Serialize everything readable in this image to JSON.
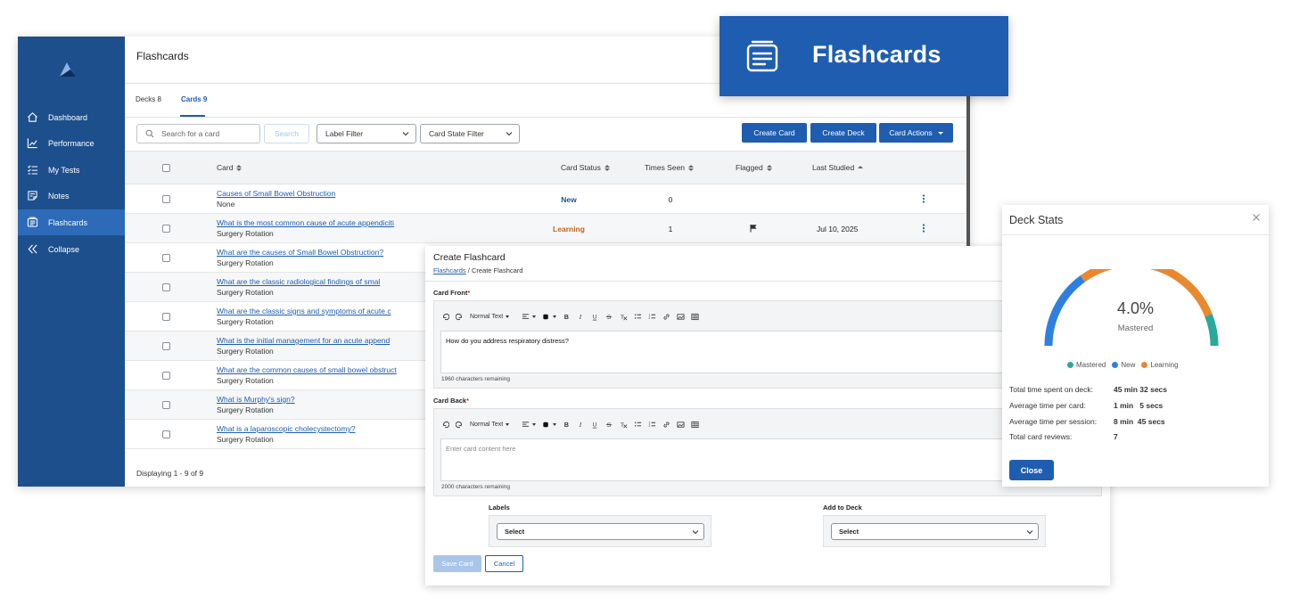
{
  "colors": {
    "brand": "#1f5db0",
    "sidebar": "#1d4f8c",
    "sidebar_active": "#2d6bb8",
    "status_new": "#1f4f9a",
    "status_learning": "#c0651a",
    "mastered": "#2aa89a",
    "new": "#2f7fe0",
    "learning": "#e8892f"
  },
  "sidebar": {
    "items": [
      {
        "label": "Dashboard",
        "icon": "home-icon"
      },
      {
        "label": "Performance",
        "icon": "chart-line-icon"
      },
      {
        "label": "My Tests",
        "icon": "checklist-icon"
      },
      {
        "label": "Notes",
        "icon": "note-icon"
      },
      {
        "label": "Flashcards",
        "icon": "flashcard-icon",
        "active": true
      },
      {
        "label": "Collapse",
        "icon": "double-chevron-left-icon"
      }
    ]
  },
  "page": {
    "title": "Flashcards"
  },
  "tabs": [
    {
      "label": "Decks 8"
    },
    {
      "label": "Cards 9",
      "active": true
    }
  ],
  "toolbar": {
    "search_placeholder": "Search for a card",
    "search_button": "Search",
    "label_filter": "Label Filter",
    "state_filter": "Card State Filter",
    "create_card": "Create Card",
    "create_deck": "Create Deck",
    "card_actions": "Card Actions"
  },
  "table": {
    "headers": {
      "card": "Card",
      "status": "Card Status",
      "seen": "Times Seen",
      "flagged": "Flagged",
      "last": "Last Studied"
    },
    "rows": [
      {
        "title": "Causes of Small Bowel Obstruction",
        "sub": "None",
        "status": "New",
        "seen": "0",
        "flagged": false,
        "date": "",
        "menu": true
      },
      {
        "title": "What is the most common cause of acute appendiciti",
        "sub": "Surgery Rotation",
        "status": "Learning",
        "seen": "1",
        "flagged": true,
        "date": "Jul 10, 2025",
        "menu": true
      },
      {
        "title": "What are the causes of Small Bowel Obstruction?",
        "sub": "Surgery Rotation"
      },
      {
        "title": "What are the classic radiological findings of smal",
        "sub": "Surgery Rotation"
      },
      {
        "title": "What are the classic signs and symptoms of acute c",
        "sub": "Surgery Rotation"
      },
      {
        "title": "What is the initial management for an acute append",
        "sub": "Surgery Rotation"
      },
      {
        "title": "What are the common causes of small bowel obstruct",
        "sub": "Surgery Rotation"
      },
      {
        "title": "What is Murphy's sign?",
        "sub": "Surgery Rotation"
      },
      {
        "title": "What is a laparoscopic cholecystectomy?",
        "sub": "Surgery Rotation"
      }
    ],
    "footer": "Displaying 1 - 9 of 9"
  },
  "header_card": {
    "title": "Flashcards",
    "icon": "flashcard-icon"
  },
  "create_modal": {
    "title": "Create Flashcard",
    "crumb_link": "Flashcards",
    "crumb_rest": " / Create Flashcard",
    "front_label": "Card Front",
    "back_label": "Card Back",
    "required_mark": "*",
    "format_label": "Normal Text",
    "front_text": "How do you address respiratory distress?",
    "front_remaining": "1960 characters remaining",
    "back_placeholder": "Enter card content here",
    "back_remaining": "2000 characters remaining",
    "labels_label": "Labels",
    "deck_label": "Add to Deck",
    "select_placeholder": "Select",
    "save": "Save Card",
    "cancel": "Cancel"
  },
  "deck_stats": {
    "title": "Deck Stats",
    "percent": "4.0%",
    "gauge_label": "Mastered",
    "legend": [
      {
        "label": "Mastered",
        "color": "#2aa89a"
      },
      {
        "label": "New",
        "color": "#2f7fe0"
      },
      {
        "label": "Learning",
        "color": "#e8892f"
      }
    ],
    "gauge_fractions": {
      "new": 0.3,
      "learning": 0.58,
      "mastered": 0.12
    },
    "rows": [
      {
        "label": "Total time spent on deck:",
        "value": "45 min 32 secs"
      },
      {
        "label": "Average time per card:",
        "value": "1 min   5 secs"
      },
      {
        "label": "Average time per session:",
        "value": "8 min  45 secs"
      },
      {
        "label": "Total card reviews:",
        "value": "7"
      }
    ],
    "close": "Close"
  }
}
